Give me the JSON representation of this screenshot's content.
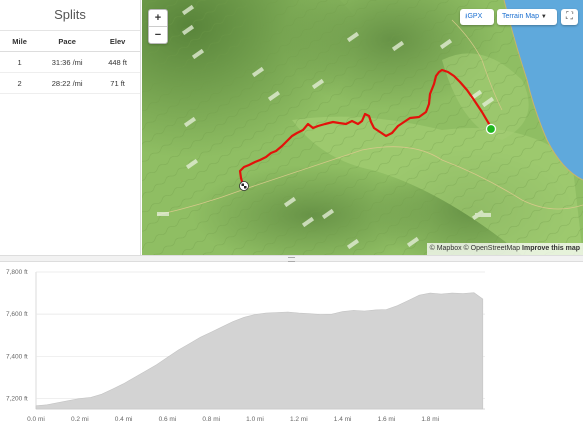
{
  "splits": {
    "title": "Splits",
    "columns": [
      "Mile",
      "Pace",
      "Elev"
    ],
    "rows": [
      {
        "mile": "1",
        "pace": "31:36 /mi",
        "elev": "448 ft"
      },
      {
        "mile": "2",
        "pace": "28:22 /mi",
        "elev": "71 ft"
      }
    ]
  },
  "map": {
    "zoom_in": "+",
    "zoom_out": "−",
    "gpx_label": "GPX",
    "terrain_label": "Terrain Map",
    "attribution_text": "© Mapbox © OpenStreetMap",
    "attribution_link": "Improve this map",
    "colors": {
      "route": "#e3120b",
      "start": "#1fb71f",
      "water": "#5fa9dc",
      "terrain": "#8fbe63"
    },
    "icons": {
      "download": "download-icon",
      "caret": "caret-down-icon",
      "fullscreen": "fullscreen-icon",
      "finish": "checkered-flag-icon"
    }
  },
  "chart_data": {
    "type": "area",
    "title": "",
    "xlabel": "",
    "ylabel": "",
    "x_unit": "mi",
    "y_unit": "ft",
    "xlim": [
      0,
      2.05
    ],
    "ylim": [
      7150,
      7800
    ],
    "x_ticks": [
      "0.0 mi",
      "0.2 mi",
      "0.4 mi",
      "0.6 mi",
      "0.8 mi",
      "1.0 mi",
      "1.2 mi",
      "1.4 mi",
      "1.6 mi",
      "1.8 mi"
    ],
    "y_ticks": [
      "7,800 ft",
      "7,600 ft",
      "7,400 ft",
      "7,200 ft"
    ],
    "x": [
      0,
      0.05,
      0.1,
      0.15,
      0.2,
      0.25,
      0.3,
      0.35,
      0.4,
      0.45,
      0.5,
      0.55,
      0.6,
      0.65,
      0.7,
      0.75,
      0.8,
      0.85,
      0.9,
      0.95,
      1.0,
      1.05,
      1.1,
      1.15,
      1.2,
      1.25,
      1.3,
      1.35,
      1.4,
      1.45,
      1.5,
      1.55,
      1.6,
      1.65,
      1.7,
      1.75,
      1.8,
      1.85,
      1.9,
      1.95,
      2.0,
      2.04
    ],
    "y": [
      7165,
      7170,
      7180,
      7190,
      7200,
      7205,
      7220,
      7245,
      7270,
      7300,
      7330,
      7360,
      7395,
      7430,
      7460,
      7490,
      7515,
      7540,
      7565,
      7585,
      7598,
      7605,
      7608,
      7610,
      7605,
      7602,
      7598,
      7600,
      7612,
      7618,
      7615,
      7620,
      7622,
      7640,
      7665,
      7690,
      7700,
      7695,
      7700,
      7698,
      7702,
      7672
    ],
    "color": "#d3d3d3",
    "grid": true
  }
}
